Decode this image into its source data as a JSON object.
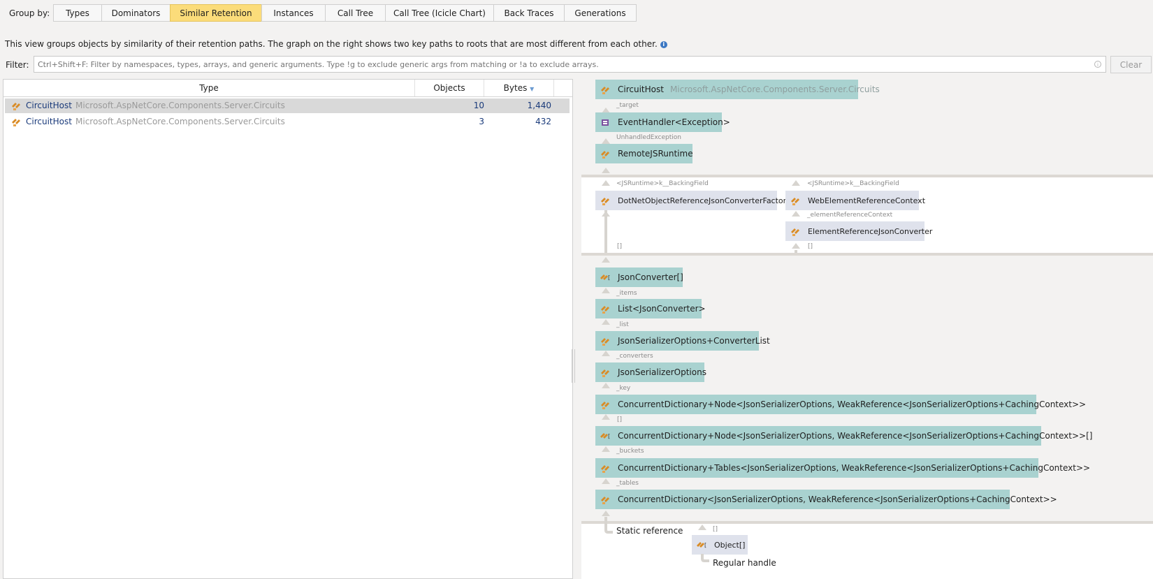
{
  "toolbar": {
    "group_by_label": "Group by:",
    "tabs": [
      {
        "label": "Types",
        "active": false
      },
      {
        "label": "Dominators",
        "active": false
      },
      {
        "label": "Similar Retention",
        "active": true
      },
      {
        "label": "Instances",
        "active": false
      },
      {
        "label": "Call Tree",
        "active": false
      },
      {
        "label": "Call Tree (Icicle Chart)",
        "active": false
      },
      {
        "label": "Back Traces",
        "active": false
      },
      {
        "label": "Generations",
        "active": false
      }
    ]
  },
  "description": "This view groups objects by similarity of their retention paths. The graph on the right shows two key paths to roots that are most different from each other.",
  "filter": {
    "label": "Filter:",
    "placeholder": "Ctrl+Shift+F: Filter by namespaces, types, arrays, and generic arguments. Type !g to exclude generic args from matching or !a to exclude arrays.",
    "value": "",
    "clear_label": "Clear"
  },
  "table": {
    "columns": [
      "Type",
      "Objects",
      "Bytes"
    ],
    "sort_column": "Bytes",
    "rows": [
      {
        "class": "CircuitHost",
        "namespace": "Microsoft.AspNetCore.Components.Server.Circuits",
        "objects": "10",
        "bytes": "1,440",
        "selected": true
      },
      {
        "class": "CircuitHost",
        "namespace": "Microsoft.AspNetCore.Components.Server.Circuits",
        "objects": "3",
        "bytes": "432",
        "selected": false
      }
    ]
  },
  "graph": {
    "nodes": {
      "circuit_host": {
        "name": "CircuitHost",
        "namespace": "Microsoft.AspNetCore.Components.Server.Circuits"
      },
      "event_handler": {
        "name": "EventHandler<Exception>"
      },
      "remote_js_runtime": {
        "name": "RemoteJSRuntime"
      },
      "dotnet_factory": {
        "name": "DotNetObjectReferenceJsonConverterFactory"
      },
      "web_element_context": {
        "name": "WebElementReferenceContext"
      },
      "element_ref_converter": {
        "name": "ElementReferenceJsonConverter"
      },
      "json_converter_array": {
        "name": "JsonConverter[]"
      },
      "list_json_converter": {
        "name": "List<JsonConverter>"
      },
      "converter_list": {
        "name": "JsonSerializerOptions+ConverterList"
      },
      "json_serializer_options": {
        "name": "JsonSerializerOptions"
      },
      "cd_node": {
        "name": "ConcurrentDictionary+Node<JsonSerializerOptions, WeakReference<JsonSerializerOptions+CachingContext>>"
      },
      "cd_node_array": {
        "name": "ConcurrentDictionary+Node<JsonSerializerOptions, WeakReference<JsonSerializerOptions+CachingContext>>[]"
      },
      "cd_tables": {
        "name": "ConcurrentDictionary+Tables<JsonSerializerOptions, WeakReference<JsonSerializerOptions+CachingContext>>"
      },
      "cd": {
        "name": "ConcurrentDictionary<JsonSerializerOptions, WeakReference<JsonSerializerOptions+CachingContext>>"
      },
      "object_array": {
        "name": "Object[]"
      }
    },
    "edges": {
      "target": "_target",
      "unhandled_exception": "UnhandledException",
      "js_runtime_backing_1": "<JSRuntime>k__BackingField",
      "js_runtime_backing_2": "<JSRuntime>k__BackingField",
      "element_reference_context": "_elementReferenceContext",
      "array_1": "[]",
      "array_2": "[]",
      "items": "_items",
      "list": "_list",
      "converters": "_converters",
      "key": "_key",
      "array_3": "[]",
      "buckets": "_buckets",
      "tables": "_tables",
      "array_4": "[]"
    },
    "roots": {
      "static_reference": "Static reference",
      "regular_handle": "Regular handle"
    }
  }
}
